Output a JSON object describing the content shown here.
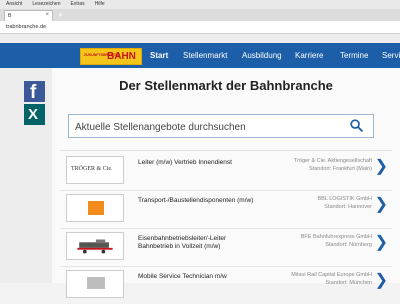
{
  "browser": {
    "menu": [
      "Ansicht",
      "Lesezeichen",
      "Extras",
      "Hilfe"
    ],
    "tab_label": "B",
    "tab_close": "×",
    "newtab": "+",
    "url": "trabnbranche.de"
  },
  "brand": {
    "small": "ZUKUNFTSBRANCHE",
    "main": "BAHN",
    "accent": "#f5c51b",
    "text": "#c4161c"
  },
  "nav": {
    "bg": "#1c5ea8",
    "items": [
      "Start",
      "Stellenmarkt",
      "Ausbildung",
      "Karriere",
      "Termine",
      "Servi"
    ]
  },
  "social": {
    "facebook": {
      "icon": "facebook-icon",
      "glyph": "f",
      "color": "#3b5998"
    },
    "xing": {
      "icon": "xing-icon",
      "glyph": "X",
      "color": "#026466"
    }
  },
  "main": {
    "title": "Der Stellenmarkt der Bahnbranche",
    "search_placeholder": "Aktuelle Stellenangebote durchsuchen"
  },
  "jobs": [
    {
      "logo_text": "TRÖGER & Cie.",
      "title": "Leiter (m/w) Vertrieb Innendienst",
      "company": "Tröger & Cie. Aktiengesellschaft",
      "location": "Standort: Frankfurt (Main)"
    },
    {
      "logo_text": "",
      "title": "Transport-/Baustellendisponenten (m/w)",
      "company": "BBL LOGISTIK GmbH",
      "location": "Standort: Hannover"
    },
    {
      "logo_text": "",
      "title": "Eisenbahnbetriebsleiter/-Leiter Bahnbetrieb in Vollzeit (m/w)",
      "company": "BFE Bahnfuhrexpress GmbH",
      "location": "Standort: Nürnberg"
    },
    {
      "logo_text": "",
      "title": "Mobile Service Technician m/w",
      "company": "Mitsui Rail Capital Europe GmbH",
      "location": "Standort: München"
    }
  ],
  "chevron": "❯"
}
